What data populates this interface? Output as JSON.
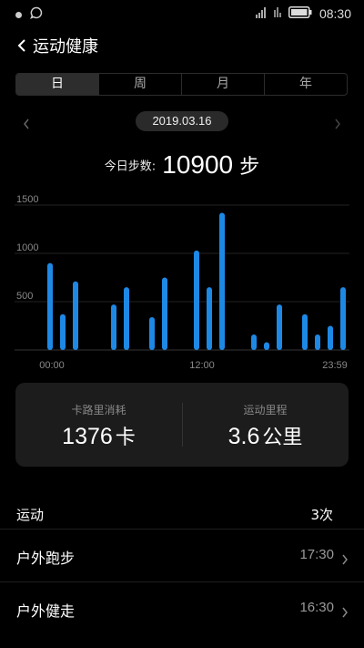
{
  "status_bar": {
    "time": "08:30",
    "icons": [
      "notification-dot-icon",
      "chat-bubble-icon",
      "signal-icon",
      "wifi-icon",
      "battery-icon"
    ]
  },
  "header": {
    "title": "运动健康",
    "back_icon": "chevron-left-icon"
  },
  "tabs": [
    {
      "label": "日",
      "active": true
    },
    {
      "label": "周",
      "active": false
    },
    {
      "label": "月",
      "active": false
    },
    {
      "label": "年",
      "active": false
    }
  ],
  "date_nav": {
    "date": "2019.03.16",
    "prev_icon": "chevron-left-icon",
    "next_icon": "chevron-right-icon"
  },
  "steps": {
    "label": "今日步数:",
    "value": "10900",
    "unit": "步"
  },
  "chart_data": {
    "type": "bar",
    "title": "",
    "xlabel": "",
    "ylabel": "",
    "ylim": [
      0,
      1500
    ],
    "yticks": [
      "1500",
      "1000",
      "500"
    ],
    "x_tick_labels": [
      "00:00",
      "12:00",
      "23:59"
    ],
    "x_range_hours": [
      0,
      24
    ],
    "grid": true,
    "bar_color": "#1e88e5",
    "series": [
      {
        "x": [
          0.5,
          1.5,
          2.5,
          5.5,
          6.5,
          8.5,
          9.5,
          12.0,
          13.0,
          14.0,
          16.5,
          17.5,
          18.5,
          20.5,
          21.5,
          22.5,
          23.5
        ],
        "values": [
          900,
          370,
          710,
          470,
          650,
          340,
          750,
          1030,
          650,
          1420,
          160,
          80,
          470,
          370,
          160,
          250,
          650
        ]
      }
    ]
  },
  "stats": {
    "calories": {
      "label": "卡路里消耗",
      "value": "1376",
      "unit": "卡"
    },
    "distance": {
      "label": "运动里程",
      "value": "3.6",
      "unit": "公里"
    }
  },
  "activities": {
    "title": "运动",
    "count": "3次",
    "items": [
      {
        "name": "户外跑步",
        "time": "17:30"
      },
      {
        "name": "户外健走",
        "time": "16:30"
      }
    ]
  }
}
